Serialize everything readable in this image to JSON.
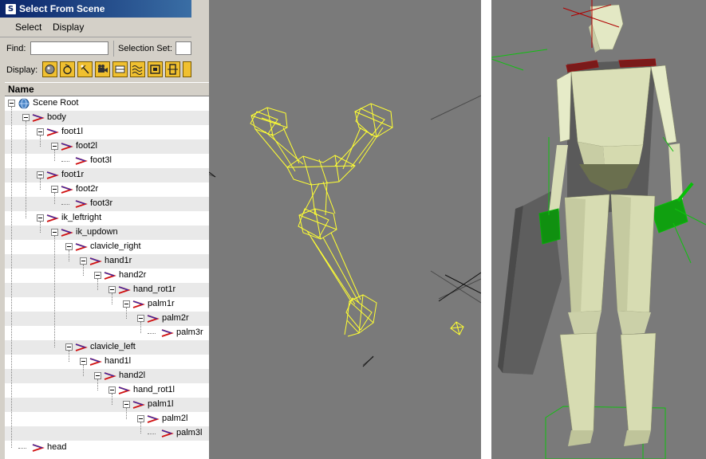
{
  "dialog": {
    "title": "Select From Scene",
    "app_icon": "3ds-max-icon",
    "menu": [
      "Select",
      "Display"
    ],
    "find_label": "Find:",
    "find_value": "",
    "selection_set_label": "Selection Set:",
    "selection_set_value": "",
    "display_label": "Display:",
    "display_buttons": [
      "geometry-sphere-icon",
      "shapes-icon",
      "lights-icon",
      "cameras-icon",
      "helpers-icon",
      "space-warps-icon",
      "groups-icon",
      "xrefs-icon"
    ],
    "column_header": "Name"
  },
  "tree": [
    {
      "label": "Scene Root",
      "depth": 0,
      "icon": "globe-icon"
    },
    {
      "label": "body",
      "depth": 1,
      "icon": "bone-icon"
    },
    {
      "label": "foot1l",
      "depth": 2,
      "icon": "bone-icon"
    },
    {
      "label": "foot2l",
      "depth": 3,
      "icon": "bone-icon"
    },
    {
      "label": "foot3l",
      "depth": 4,
      "icon": "bone-icon"
    },
    {
      "label": "foot1r",
      "depth": 2,
      "icon": "bone-icon"
    },
    {
      "label": "foot2r",
      "depth": 3,
      "icon": "bone-icon"
    },
    {
      "label": "foot3r",
      "depth": 4,
      "icon": "bone-icon"
    },
    {
      "label": "ik_leftright",
      "depth": 2,
      "icon": "bone-icon"
    },
    {
      "label": "ik_updown",
      "depth": 3,
      "icon": "bone-icon"
    },
    {
      "label": "clavicle_right",
      "depth": 4,
      "icon": "bone-icon"
    },
    {
      "label": "hand1r",
      "depth": 5,
      "icon": "bone-icon"
    },
    {
      "label": "hand2r",
      "depth": 6,
      "icon": "bone-icon"
    },
    {
      "label": "hand_rot1r",
      "depth": 7,
      "icon": "bone-icon"
    },
    {
      "label": "palm1r",
      "depth": 8,
      "icon": "bone-icon"
    },
    {
      "label": "palm2r",
      "depth": 9,
      "icon": "bone-icon"
    },
    {
      "label": "palm3r",
      "depth": 10,
      "icon": "bone-icon"
    },
    {
      "label": "clavicle_left",
      "depth": 4,
      "icon": "bone-icon"
    },
    {
      "label": "hand1l",
      "depth": 5,
      "icon": "bone-icon"
    },
    {
      "label": "hand2l",
      "depth": 6,
      "icon": "bone-icon"
    },
    {
      "label": "hand_rot1l",
      "depth": 7,
      "icon": "bone-icon"
    },
    {
      "label": "palm1l",
      "depth": 8,
      "icon": "bone-icon"
    },
    {
      "label": "palm2l",
      "depth": 9,
      "icon": "bone-icon"
    },
    {
      "label": "palm3l",
      "depth": 10,
      "icon": "bone-icon"
    },
    {
      "label": "head",
      "depth": 1,
      "icon": "bone-icon"
    }
  ],
  "viewports": {
    "left": {
      "background": "#7a7a7a",
      "wireframe_color": "#ffff33"
    },
    "right": {
      "background": "#7b7b7b",
      "mesh_color": "#d9dfb4",
      "selection_color": "#10c010"
    }
  }
}
